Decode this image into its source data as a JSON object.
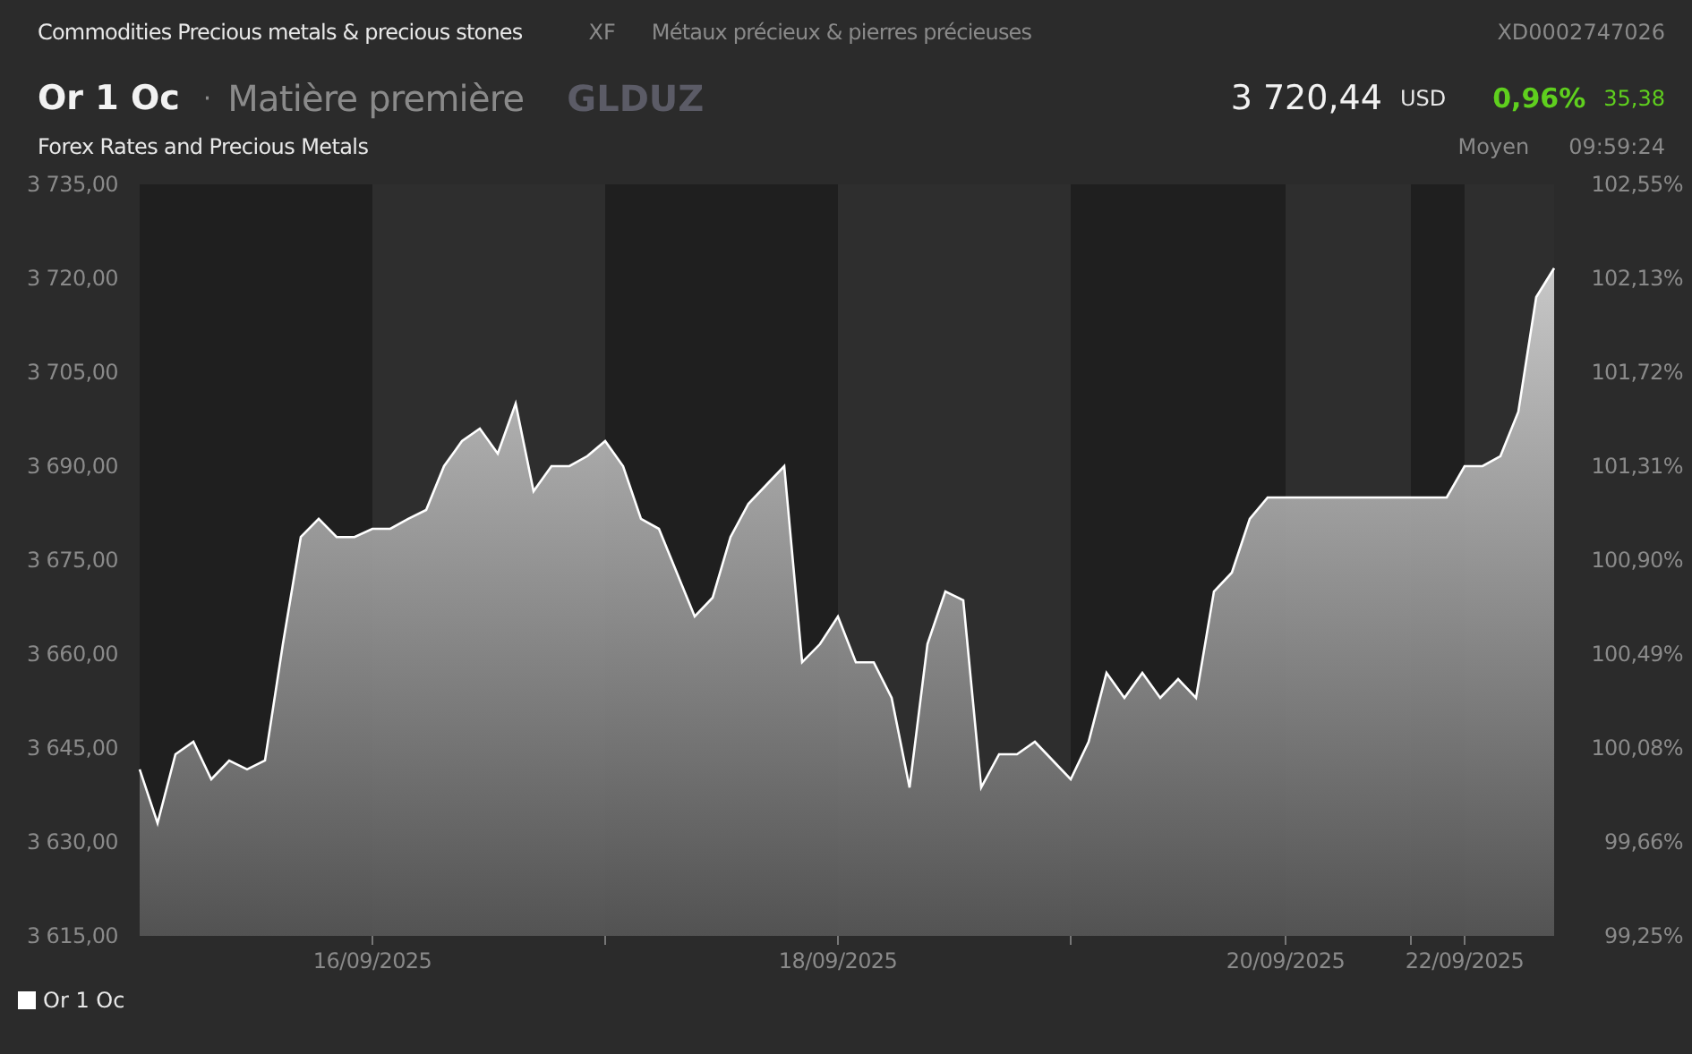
{
  "header": {
    "category": "Commodities Precious metals & precious stones",
    "exchange": "XF",
    "category_fr": "Métaux précieux & pierres précieuses",
    "isin": "XD0002747026"
  },
  "instrument": {
    "name": "Or 1 Oc",
    "separator": "·",
    "type": "Matière première",
    "ticker": "GLDUZ",
    "market": "Forex Rates and Precious Metals",
    "price": "3 720,44",
    "currency": "USD",
    "change_pct": "0,96%",
    "change": "35,38",
    "price_type": "Moyen",
    "time": "09:59:24"
  },
  "chart": {
    "right_ticks": [
      "102,55%",
      "102,13%",
      "101,72%",
      "101,31%",
      "100,90%",
      "100,49%",
      "100,08%",
      "99,66%",
      "99,25%"
    ],
    "chart_data": {
      "type": "area",
      "series": [
        {
          "name": "Or 1 Oc",
          "color": "#ffffff",
          "values": [
            3641.6,
            3633,
            3644,
            3646,
            3640,
            3643,
            3641.6,
            3643,
            3661.6,
            3678.7,
            3681.6,
            3678.7,
            3678.7,
            3680,
            3680,
            3681.6,
            3683,
            3690,
            3694,
            3696,
            3692,
            3700,
            3686,
            3690,
            3690,
            3691.6,
            3694,
            3690,
            3681.6,
            3680,
            3673,
            3666,
            3669,
            3678.7,
            3684,
            3687,
            3690,
            3658.7,
            3661.6,
            3666,
            3658.7,
            3658.7,
            3653,
            3638.7,
            3661.6,
            3670,
            3668.6,
            3638.7,
            3644,
            3644,
            3646,
            3643,
            3640,
            3646,
            3657,
            3653,
            3657,
            3653,
            3656,
            3653,
            3670,
            3673,
            3681.6,
            3685,
            3685,
            3685,
            3685,
            3685,
            3685,
            3685,
            3685,
            3685,
            3685,
            3685,
            3690,
            3690,
            3691.6,
            3698.7,
            3717,
            3721.6
          ]
        }
      ],
      "ylim": [
        3615,
        3735
      ],
      "yticks": [
        {
          "value": 3735,
          "label": "3 735,00"
        },
        {
          "value": 3720,
          "label": "3 720,00"
        },
        {
          "value": 3705,
          "label": "3 705,00"
        },
        {
          "value": 3690,
          "label": "3 690,00"
        },
        {
          "value": 3675,
          "label": "3 675,00"
        },
        {
          "value": 3660,
          "label": "3 660,00"
        },
        {
          "value": 3645,
          "label": "3 645,00"
        },
        {
          "value": 3630,
          "label": "3 630,00"
        },
        {
          "value": 3615,
          "label": "3 615,00"
        }
      ],
      "categories": [
        null,
        null,
        null,
        null,
        null,
        null,
        null,
        null,
        null,
        null,
        null,
        null,
        null,
        "16/09/2025",
        null,
        null,
        null,
        null,
        null,
        null,
        null,
        null,
        null,
        null,
        null,
        null,
        null,
        null,
        null,
        null,
        null,
        null,
        null,
        null,
        null,
        null,
        null,
        null,
        null,
        "18/09/2025",
        null,
        null,
        null,
        null,
        null,
        null,
        null,
        null,
        null,
        null,
        null,
        null,
        null,
        null,
        null,
        null,
        null,
        null,
        null,
        null,
        null,
        null,
        null,
        null,
        "20/09/2025",
        null,
        null,
        null,
        null,
        null,
        null,
        null,
        null,
        null,
        "22/09/2025",
        null,
        null,
        null,
        null,
        null
      ]
    }
  }
}
